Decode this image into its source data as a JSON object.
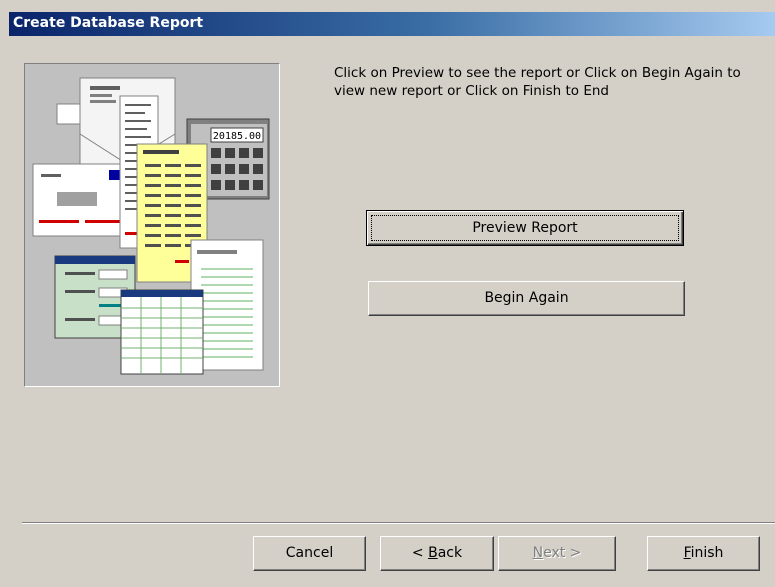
{
  "window": {
    "title": "Create Database Report"
  },
  "instructions": "Click on Preview to see the report or Click on Begin Again to view new report or Click on Finish to End",
  "buttons": {
    "preview": "Preview Report",
    "begin_again": "Begin Again",
    "cancel": "Cancel",
    "back": {
      "mnemonic": "B",
      "label": "ack",
      "prefix": "< "
    },
    "next": {
      "mnemonic": "N",
      "label": "ext >"
    },
    "finish": {
      "mnemonic": "F",
      "label": "inish"
    }
  },
  "button_state": {
    "next_enabled": false,
    "default_button": "preview"
  },
  "illustration": {
    "calculator_display": "20185.00"
  }
}
